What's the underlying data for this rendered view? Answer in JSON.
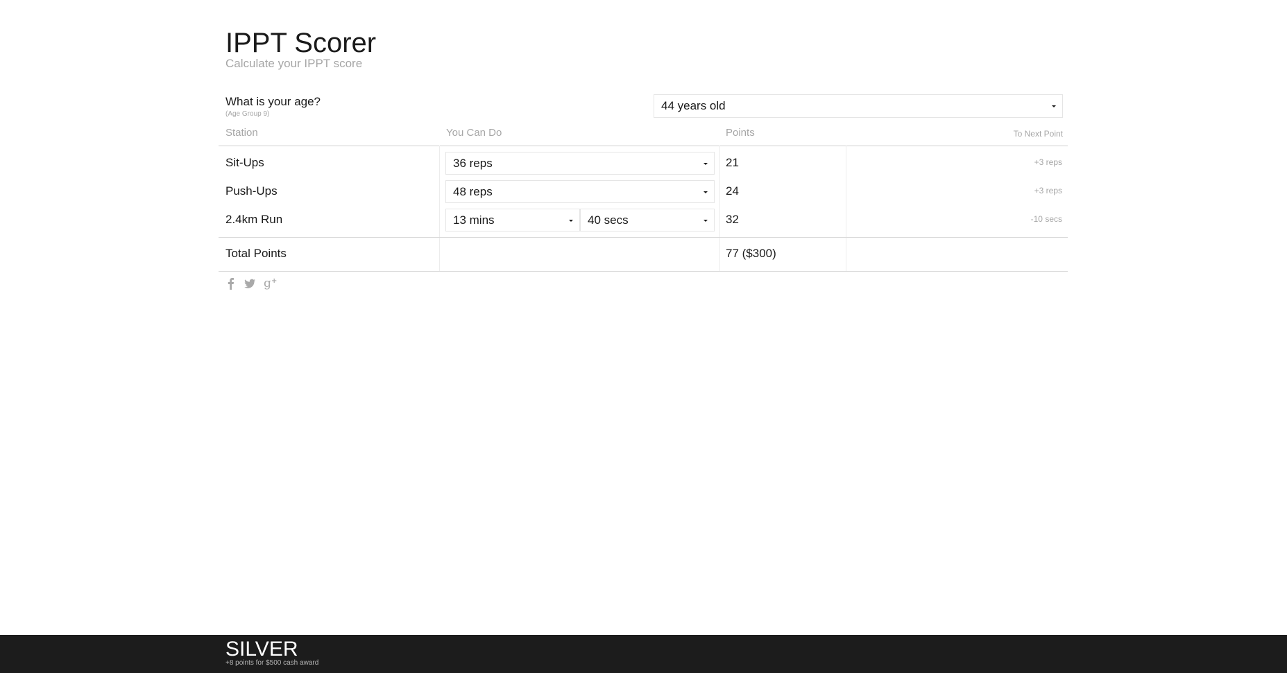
{
  "header": {
    "title": "IPPT Scorer",
    "subtitle": "Calculate your IPPT score"
  },
  "age": {
    "question": "What is your age?",
    "group": "(Age Group 9)",
    "selected": "44 years old"
  },
  "table": {
    "headers": {
      "station": "Station",
      "you_can_do": "You Can Do",
      "points": "Points",
      "to_next_point": "To Next Point"
    },
    "rows": [
      {
        "station": "Sit-Ups",
        "value": "36 reps",
        "points": "21",
        "to_next": "+3 reps"
      },
      {
        "station": "Push-Ups",
        "value": "48 reps",
        "points": "24",
        "to_next": "+3 reps"
      },
      {
        "station": "2.4km Run",
        "minutes": "13 mins",
        "seconds": "40 secs",
        "points": "32",
        "to_next": "-10 secs"
      }
    ],
    "total": {
      "label": "Total Points",
      "value": "77 ($300)"
    }
  },
  "social": {
    "icons": [
      "facebook-icon",
      "twitter-icon",
      "google-plus-icon"
    ]
  },
  "footer": {
    "award": "SILVER",
    "note": "+8 points for $500 cash award"
  },
  "colors": {
    "text": "#1a1a1a",
    "muted": "#a6a6a6",
    "footer_bg": "#1c1c1c"
  }
}
